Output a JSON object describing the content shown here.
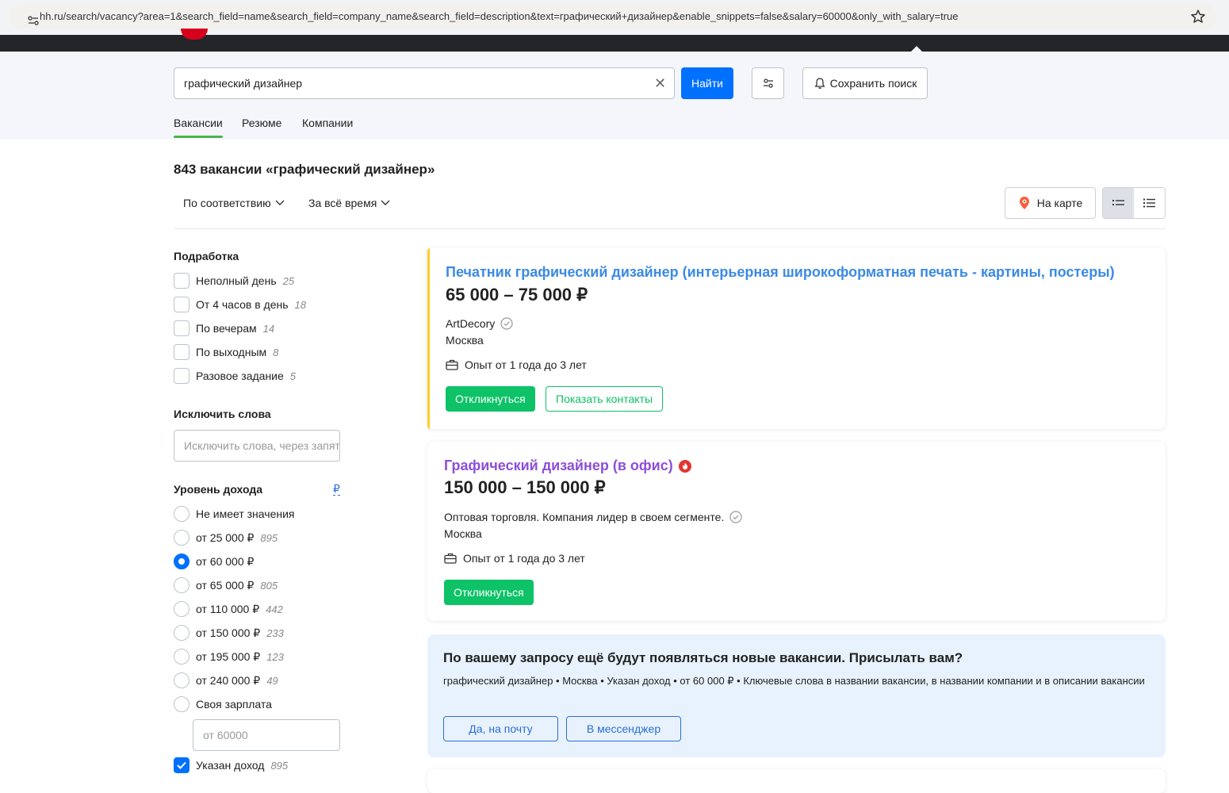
{
  "browser": {
    "url": "hh.ru/search/vacancy?area=1&search_field=name&search_field=company_name&search_field=description&text=графический+дизайнер&enable_snippets=false&salary=60000&only_with_salary=true"
  },
  "search": {
    "query": "графический дизайнер",
    "find_label": "Найти",
    "save_label": "Сохранить поиск"
  },
  "tabs": [
    {
      "label": "Вакансии",
      "active": true
    },
    {
      "label": "Резюме",
      "active": false
    },
    {
      "label": "Компании",
      "active": false
    }
  ],
  "results": {
    "title": "843 вакансии «графический дизайнер»",
    "sort_relevance": "По соответствию",
    "sort_period": "За всё время",
    "map_label": "На карте"
  },
  "sidebar": {
    "parttime": {
      "title": "Подработка",
      "items": [
        {
          "label": "Неполный день",
          "count": "25"
        },
        {
          "label": "От 4 часов в день",
          "count": "18"
        },
        {
          "label": "По вечерам",
          "count": "14"
        },
        {
          "label": "По выходным",
          "count": "8"
        },
        {
          "label": "Разовое задание",
          "count": "5"
        }
      ]
    },
    "exclude": {
      "title": "Исключить слова",
      "placeholder": "Исключить слова, через запятую"
    },
    "income": {
      "title": "Уровень дохода",
      "currency": "₽",
      "options": [
        {
          "label": "Не имеет значения",
          "count": "",
          "selected": false
        },
        {
          "label": "от 25 000 ₽",
          "count": "895",
          "selected": false
        },
        {
          "label": "от 60 000 ₽",
          "count": "",
          "selected": true
        },
        {
          "label": "от 65 000 ₽",
          "count": "805",
          "selected": false
        },
        {
          "label": "от 110 000 ₽",
          "count": "442",
          "selected": false
        },
        {
          "label": "от 150 000 ₽",
          "count": "233",
          "selected": false
        },
        {
          "label": "от 195 000 ₽",
          "count": "123",
          "selected": false
        },
        {
          "label": "от 240 000 ₽",
          "count": "49",
          "selected": false
        },
        {
          "label": "Своя зарплата",
          "count": "",
          "selected": false
        }
      ],
      "own_placeholder": "от 60000",
      "specified": {
        "label": "Указан доход",
        "count": "895",
        "checked": true
      }
    }
  },
  "vacancies": [
    {
      "title": "Печатник графический дизайнер (интерьерная широкоформатная печать - картины, постеры)",
      "title_color": "#2a6ed6",
      "salary": "65 000 – 75 000 ₽",
      "company": "ArtDecory",
      "city": "Москва",
      "experience": "Опыт от 1 года до 3 лет",
      "respond_label": "Откликнуться",
      "contacts_label": "Показать контакты"
    },
    {
      "title": "Графический дизайнер (в офис)",
      "title_color": "#8d4fd8",
      "salary": "150 000 – 150 000 ₽",
      "company": "Оптовая торговля. Компания лидер в своем сегменте.",
      "city": "Москва",
      "experience": "Опыт от 1 года до 3 лет",
      "respond_label": "Откликнуться"
    }
  ],
  "notify": {
    "title": "По вашему запросу ещё будут появляться новые вакансии. Присылать вам?",
    "description": "графический дизайнер • Москва • Указан доход • от 60 000 ₽ • Ключевые слова в названии вакансии, в названии компании и в описании вакансии",
    "email_label": "Да, на почту",
    "messenger_label": "В мессенджер"
  },
  "colors": {
    "accent": "#0070ff",
    "respond_green": "#0dc267",
    "highlight_border": "#ffcd29",
    "hot_badge": "#e3342f"
  }
}
